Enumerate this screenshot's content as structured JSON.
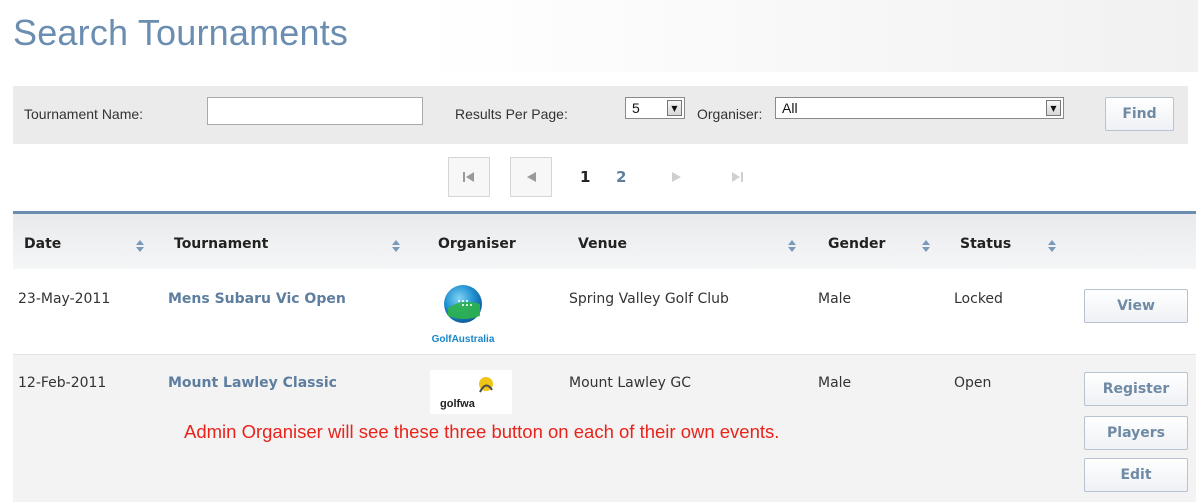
{
  "page": {
    "title": "Search Tournaments"
  },
  "filters": {
    "tournament_name_label": "Tournament Name:",
    "tournament_name_value": "",
    "results_per_page_label": "Results Per Page:",
    "results_per_page_value": "5",
    "organiser_label": "Organiser:",
    "organiser_value": "All",
    "find_label": "Find"
  },
  "pager": {
    "pages": [
      "1",
      "2"
    ],
    "current_page": "1",
    "first_icon": "first-page-icon",
    "prev_icon": "prev-page-icon",
    "next_icon": "next-page-icon",
    "last_icon": "last-page-icon"
  },
  "table": {
    "columns": [
      "Date",
      "Tournament",
      "Organiser",
      "Venue",
      "Gender",
      "Status"
    ],
    "rows": [
      {
        "date": "23-May-2011",
        "tournament": "Mens Subaru Vic Open",
        "organiser_logo_text": "GolfAustralia",
        "venue": "Spring Valley Golf Club",
        "gender": "Male",
        "status": "Locked",
        "actions": [
          "View"
        ]
      },
      {
        "date": "12-Feb-2011",
        "tournament": "Mount Lawley Classic",
        "organiser_logo_text": "golfwa",
        "venue": "Mount Lawley GC",
        "gender": "Male",
        "status": "Open",
        "actions": [
          "Register",
          "Players",
          "Edit"
        ]
      }
    ]
  },
  "annotation": "Admin Organiser will see these three button on each of their own events.",
  "colors": {
    "title": "#6b8db0",
    "link": "#5e7ea0",
    "annotation": "#e8231b",
    "header_rule": "#6b8db0"
  }
}
